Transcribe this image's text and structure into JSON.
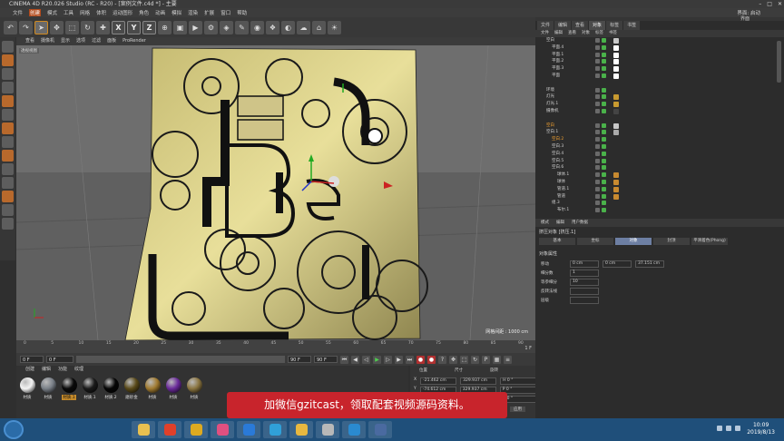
{
  "window": {
    "title": "CINEMA 4D R20.026 Studio (RC - R20) - [案例文件.c4d *] - 主要"
  },
  "menu": {
    "items": [
      "文件",
      "创建",
      "模式",
      "工具",
      "网格",
      "体积",
      "运动图形",
      "角色",
      "动画",
      "模拟",
      "渲染",
      "扩展",
      "窗口",
      "帮助"
    ],
    "layout_label": "界面:",
    "layout_value": "启动"
  },
  "toolbar": {
    "x": "X",
    "y": "Y",
    "z": "Z"
  },
  "viewport": {
    "menu": [
      "查看",
      "摄像机",
      "显示",
      "选项",
      "过滤",
      "面板",
      "ProRender"
    ],
    "tag": "透视视图",
    "grid_info": "网格间距 : 1000 cm"
  },
  "timeline": {
    "ticks": [
      "0",
      "5",
      "10",
      "15",
      "20",
      "25",
      "30",
      "35",
      "40",
      "45",
      "50",
      "55",
      "60",
      "65",
      "70",
      "75",
      "80",
      "85",
      "90"
    ],
    "end_label": "1 F"
  },
  "playback": {
    "start_field": "0 F",
    "cur_field": "0 F",
    "end_field": "90 F",
    "max_field": "90 F"
  },
  "materials": {
    "menu": [
      "创建",
      "编辑",
      "功能",
      "纹理"
    ],
    "items": [
      {
        "label": "材质",
        "color": "#f4f4f4",
        "selected": false
      },
      {
        "label": "材质",
        "color": "#7a8088",
        "selected": false
      },
      {
        "label": "材质.1",
        "color": "#0a0a0a",
        "selected": true
      },
      {
        "label": "材质.1",
        "color": "#1a1a1a",
        "selected": false
      },
      {
        "label": "材质.2",
        "color": "#050505",
        "selected": false
      },
      {
        "label": "磨砂金",
        "color": "#5a4a1a",
        "selected": false
      },
      {
        "label": "材质",
        "color": "#a07a30",
        "selected": false
      },
      {
        "label": "材质",
        "color": "#6a2a9a",
        "selected": false
      },
      {
        "label": "材质",
        "color": "#8a7440",
        "selected": false
      }
    ]
  },
  "coords": {
    "headers": [
      "位置",
      "尺寸",
      "旋转"
    ],
    "rows": [
      {
        "axis": "X",
        "pos": "-21.462 cm",
        "size": "329.937 cm",
        "rot": "H 0 °"
      },
      {
        "axis": "Y",
        "pos": "-74.612 cm",
        "size": "329.937 cm",
        "rot": "P 0 °"
      },
      {
        "axis": "Z",
        "pos": "",
        "size": "",
        "rot": "B 0 °"
      }
    ],
    "apply_label": "应用"
  },
  "right_panel": {
    "layout_label": "界面",
    "tabs": [
      "文件",
      "编辑",
      "查看",
      "对象",
      "标签",
      "书签"
    ],
    "active_tab": "对象",
    "om_menu": [
      "文件",
      "编辑",
      "查看",
      "对象",
      "标签",
      "书签"
    ],
    "objects": [
      {
        "name": "空白",
        "indent": 1,
        "tag": "#c8c8c8",
        "sel": false
      },
      {
        "name": "平面.4",
        "indent": 2,
        "tag": "#ffffff",
        "sel": false
      },
      {
        "name": "平面.1",
        "indent": 2,
        "tag": "#ffffff",
        "sel": false
      },
      {
        "name": "平面.2",
        "indent": 2,
        "tag": "#ffffff",
        "sel": false
      },
      {
        "name": "平面.3",
        "indent": 2,
        "tag": "#ffffff",
        "sel": false
      },
      {
        "name": "平面",
        "indent": 2,
        "tag": "#ffffff",
        "sel": false
      },
      {
        "name": "",
        "indent": 0,
        "tag": "",
        "sel": false
      },
      {
        "name": "环境",
        "indent": 1,
        "tag": "",
        "sel": false
      },
      {
        "name": "灯光",
        "indent": 1,
        "tag": "#c89a30",
        "sel": false
      },
      {
        "name": "灯光.1",
        "indent": 1,
        "tag": "#c89a30",
        "sel": false
      },
      {
        "name": "摄像机",
        "indent": 1,
        "tag": "#444444",
        "sel": false
      },
      {
        "name": "",
        "indent": 0,
        "tag": "",
        "sel": false
      },
      {
        "name": "空白",
        "indent": 1,
        "tag": "#c8c8c8",
        "sel": true
      },
      {
        "name": "空白.1",
        "indent": 1,
        "tag": "#aaaaaa",
        "sel": false
      },
      {
        "name": "空白.2",
        "indent": 2,
        "tag": "",
        "sel": true
      },
      {
        "name": "空白.3",
        "indent": 2,
        "tag": "",
        "sel": false
      },
      {
        "name": "空白.4",
        "indent": 2,
        "tag": "",
        "sel": false
      },
      {
        "name": "空白.5",
        "indent": 2,
        "tag": "",
        "sel": false
      },
      {
        "name": "空白.6",
        "indent": 2,
        "tag": "",
        "sel": false
      },
      {
        "name": "球体.1",
        "indent": 3,
        "tag": "#c88a30",
        "sel": false
      },
      {
        "name": "球体",
        "indent": 3,
        "tag": "#c88a30",
        "sel": false
      },
      {
        "name": "管道.1",
        "indent": 3,
        "tag": "#c88a30",
        "sel": false
      },
      {
        "name": "管道",
        "indent": 3,
        "tag": "#c88a30",
        "sel": false
      },
      {
        "name": "组.3",
        "indent": 2,
        "tag": "",
        "sel": false
      },
      {
        "name": "布尔.1",
        "indent": 3,
        "tag": "",
        "sel": false
      }
    ],
    "attr_menu": [
      "模式",
      "编辑",
      "用户数据"
    ],
    "attr_title": "挤压对象 [挤压.1]",
    "attr_tabs": [
      "基本",
      "坐标",
      "对象",
      "封顶",
      "平滑着色(Phong)"
    ],
    "attr_active_tab": "对象",
    "attr_section": "对象属性",
    "attr_rows": [
      {
        "label": "移动",
        "v1": "0 cm",
        "v2": "0 cm",
        "v3": "37.151 cm"
      },
      {
        "label": "细分数",
        "v1": "1",
        "v2": "",
        "v3": ""
      },
      {
        "label": "等参细分",
        "v1": "10",
        "v2": "",
        "v3": ""
      },
      {
        "label": "反转法线",
        "v1": "",
        "v2": "",
        "v3": ""
      },
      {
        "label": "层级",
        "v1": "",
        "v2": "",
        "v3": ""
      }
    ]
  },
  "banner": {
    "text": "加微信gzitcast，领取配套视频源码资料。"
  },
  "taskbar": {
    "apps": [
      {
        "name": "explorer",
        "color": "#e8c050"
      },
      {
        "name": "app-2",
        "color": "#e0402a"
      },
      {
        "name": "chrome",
        "color": "#ddaa20"
      },
      {
        "name": "app-4",
        "color": "#e05080"
      },
      {
        "name": "app-5",
        "color": "#2a7ad8"
      },
      {
        "name": "app-6",
        "color": "#30a0d8"
      },
      {
        "name": "folder",
        "color": "#e8b840"
      },
      {
        "name": "app-8",
        "color": "#b8b8b8"
      },
      {
        "name": "app-9",
        "color": "#2a8ad0"
      },
      {
        "name": "cinema4d",
        "color": "#4a6aa0"
      }
    ],
    "time": "10:09",
    "date": "2019/8/13"
  }
}
